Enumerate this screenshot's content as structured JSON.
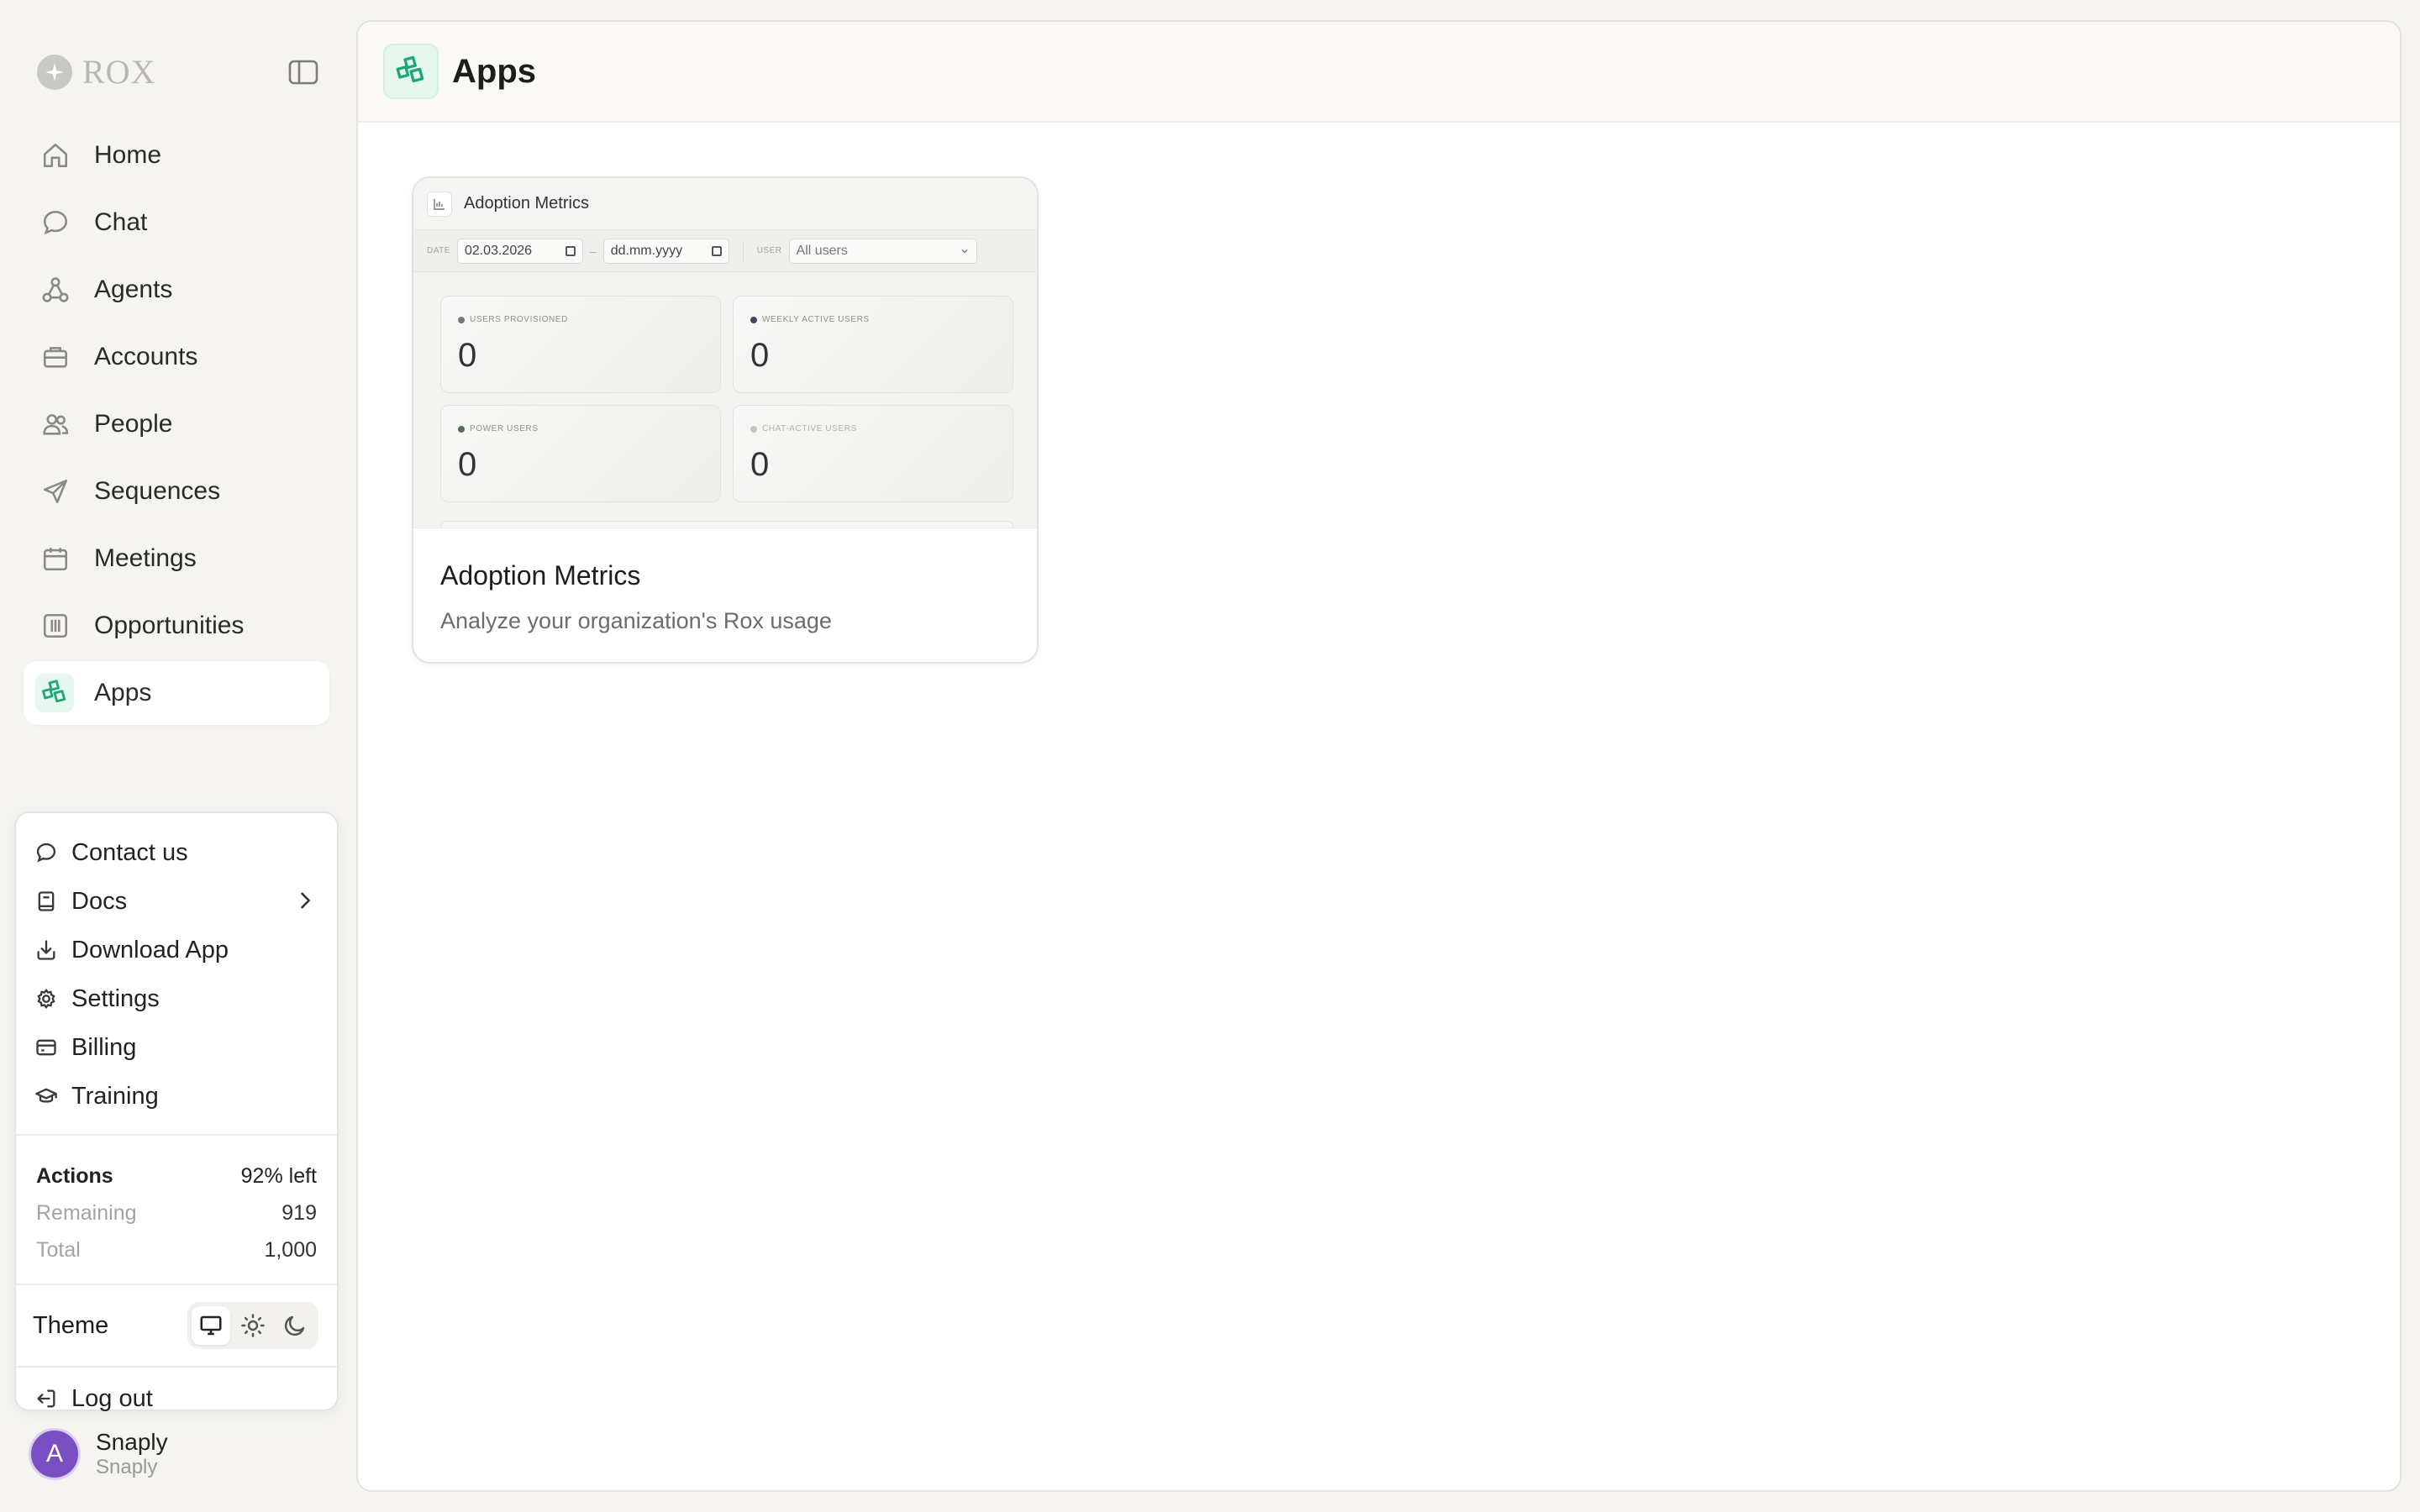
{
  "brand": {
    "name": "ROX"
  },
  "nav": {
    "items": [
      {
        "label": "Home",
        "icon": "home-icon"
      },
      {
        "label": "Chat",
        "icon": "chat-icon"
      },
      {
        "label": "Agents",
        "icon": "agents-icon"
      },
      {
        "label": "Accounts",
        "icon": "briefcase-icon"
      },
      {
        "label": "People",
        "icon": "people-icon"
      },
      {
        "label": "Sequences",
        "icon": "send-icon"
      },
      {
        "label": "Meetings",
        "icon": "calendar-icon"
      },
      {
        "label": "Opportunities",
        "icon": "columns-icon"
      },
      {
        "label": "Apps",
        "icon": "apps-icon",
        "active": true
      }
    ]
  },
  "menu": {
    "items": [
      {
        "label": "Contact us",
        "icon": "message-icon"
      },
      {
        "label": "Docs",
        "icon": "book-icon",
        "submenu": true
      },
      {
        "label": "Download App",
        "icon": "download-icon"
      },
      {
        "label": "Settings",
        "icon": "gear-icon"
      },
      {
        "label": "Billing",
        "icon": "credit-card-icon"
      },
      {
        "label": "Training",
        "icon": "graduation-cap-icon"
      }
    ],
    "usage": {
      "title": "Actions",
      "percent_left": "92% left",
      "remaining_label": "Remaining",
      "remaining_value": "919",
      "total_label": "Total",
      "total_value": "1,000"
    },
    "theme": {
      "label": "Theme",
      "options": [
        "system",
        "light",
        "dark"
      ],
      "selected": "system"
    },
    "logout_label": "Log out"
  },
  "user": {
    "avatar_initial": "A",
    "name": "Snaply",
    "org": "Snaply"
  },
  "main": {
    "title": "Apps",
    "apps": [
      {
        "title": "Adoption Metrics",
        "description": "Analyze your organization's Rox usage",
        "preview": {
          "title": "Adoption Metrics",
          "date_label": "DATE",
          "date_from": "02.03.2026",
          "date_to": "dd.mm.yyyy",
          "user_label": "USER",
          "user_value": "All users",
          "metrics": [
            {
              "label": "USERS PROVISIONED",
              "value": "0"
            },
            {
              "label": "WEEKLY ACTIVE USERS",
              "value": "0"
            },
            {
              "label": "POWER USERS",
              "value": "0"
            },
            {
              "label": "CHAT-ACTIVE USERS",
              "value": "0"
            }
          ]
        }
      }
    ]
  },
  "colors": {
    "accent": "#1fa874",
    "accent_bg": "#e6f7ef",
    "avatar": "#7a4fc4"
  }
}
